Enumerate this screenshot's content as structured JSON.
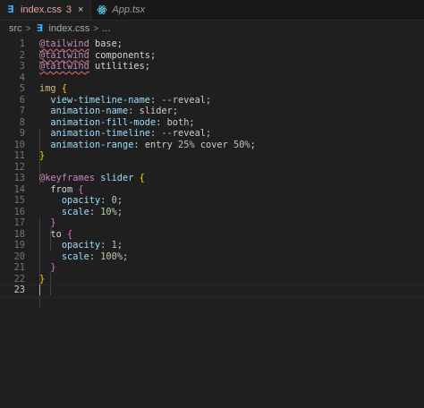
{
  "tabs": [
    {
      "label": "index.css",
      "badge": "3",
      "close": "×",
      "active": true
    },
    {
      "label": "App.tsx",
      "active": false
    }
  ],
  "breadcrumb": {
    "folder": "src",
    "file": "index.css",
    "tail": "..."
  },
  "line_numbers": [
    "1",
    "2",
    "3",
    "4",
    "5",
    "6",
    "7",
    "8",
    "9",
    "10",
    "11",
    "12",
    "13",
    "14",
    "15",
    "16",
    "17",
    "18",
    "19",
    "20",
    "21",
    "22",
    "23"
  ],
  "code": {
    "l1_at": "@tailwind",
    "l1_rest": " base;",
    "l2_at": "@tailwind",
    "l2_rest": " components;",
    "l3_at": "@tailwind",
    "l3_rest": " utilities;",
    "l5_sel": "img",
    "l5_brace": "{",
    "l6_prop": "view-timeline-name",
    "l6_val": "--reveal",
    "l7_prop": "animation-name",
    "l7_val": "slider",
    "l8_prop": "animation-fill-mode",
    "l8_val": "both",
    "l9_prop": "animation-timeline",
    "l9_val": "--reveal",
    "l10_prop": "animation-range",
    "l10_a": "entry",
    "l10_b": "25%",
    "l10_c": "cover",
    "l10_d": "50%",
    "l11_brace": "}",
    "l13_kw": "@keyframes",
    "l13_name": "slider",
    "l13_brace": "{",
    "l14_sel": "from",
    "l14_brace": "{",
    "l15_prop": "opacity",
    "l15_val": "0",
    "l16_prop": "scale",
    "l16_val": "10%",
    "l17_brace": "}",
    "l18_sel": "to",
    "l18_brace": "{",
    "l19_prop": "opacity",
    "l19_val": "1",
    "l20_prop": "scale",
    "l20_val": "100%",
    "l21_brace": "}",
    "l22_brace": "}"
  },
  "colors": {
    "background": "#1f1f1f",
    "tab_active_text": "#e8a2a2",
    "css_icon": "#3ea6ff",
    "react_icon": "#61dafb"
  }
}
